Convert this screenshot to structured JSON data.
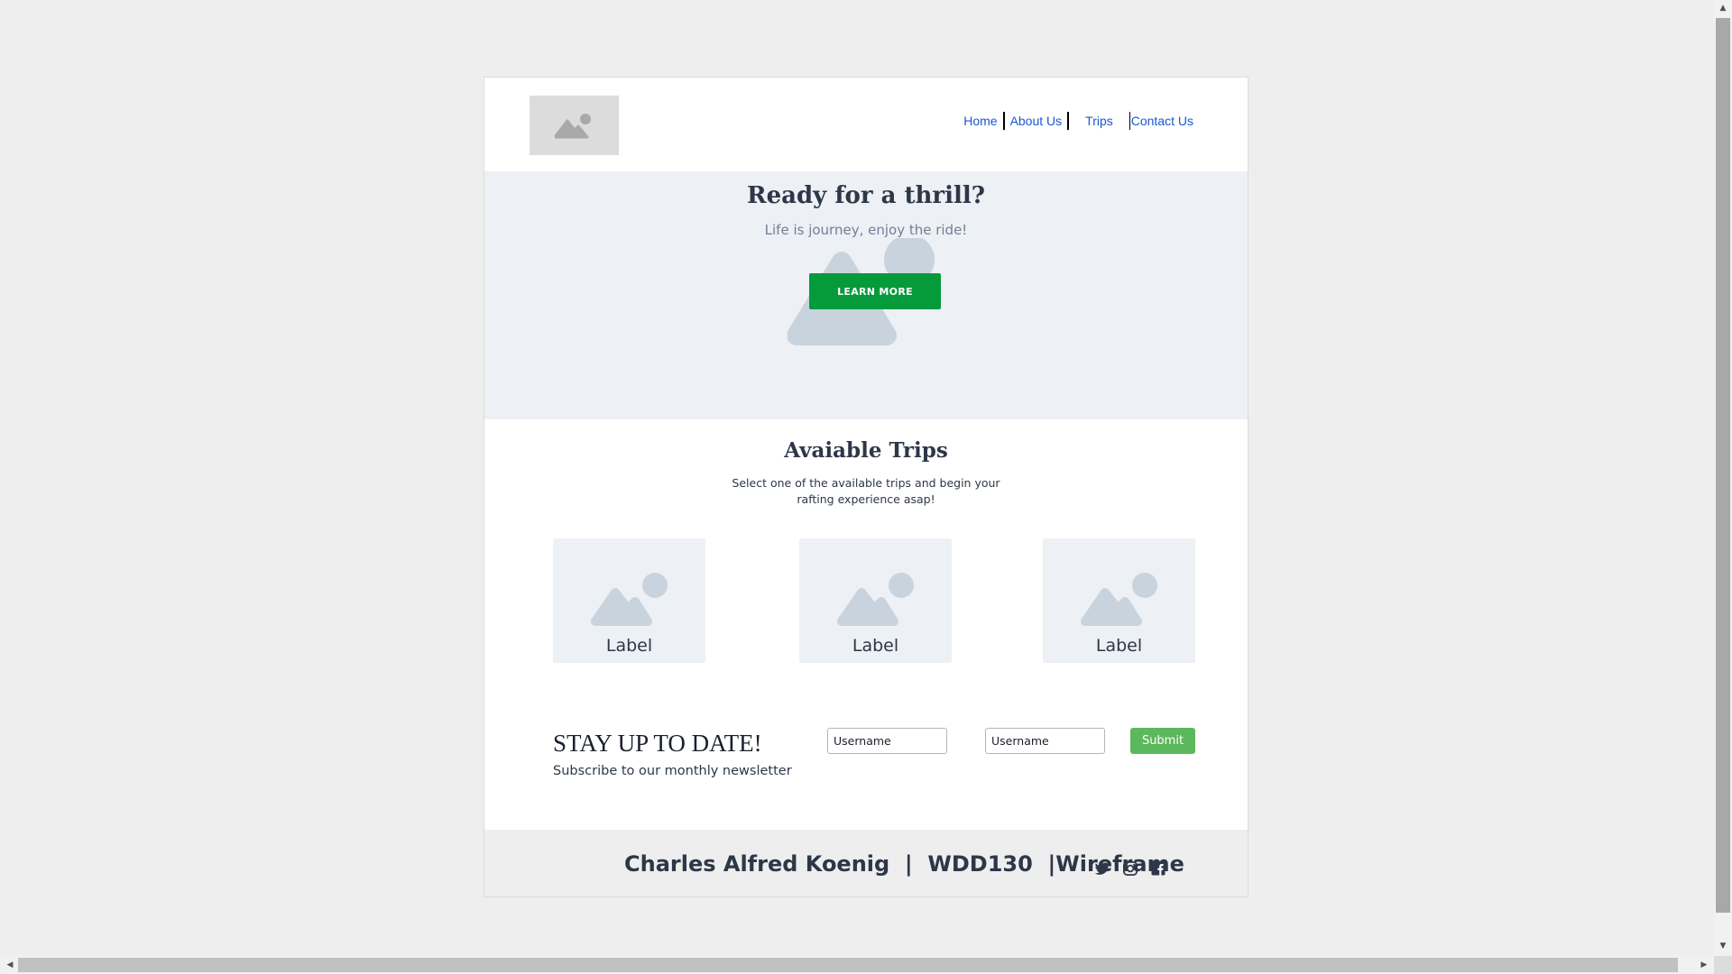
{
  "nav": {
    "items": [
      {
        "label": "Home"
      },
      {
        "label": "About Us"
      },
      {
        "label": "Trips"
      },
      {
        "label": "Contact Us"
      }
    ],
    "link_color": "#1a56d6"
  },
  "hero": {
    "title": "Ready for a thrill?",
    "subtitle": "Life is journey, enjoy the ride!",
    "button_label": "LEARN MORE",
    "button_color": "#059a3a"
  },
  "trips": {
    "title": "Avaiable Trips",
    "subtitle": "Select one of the available trips and begin your rafting experience asap!",
    "cards": [
      {
        "label": "Label",
        "icon": "image-placeholder-icon"
      },
      {
        "label": "Label",
        "icon": "image-placeholder-icon"
      },
      {
        "label": "Label",
        "icon": "image-placeholder-icon"
      }
    ]
  },
  "newsletter": {
    "title": "STAY UP TO DATE!",
    "subtitle": "Subscribe to our monthly newsletter",
    "inputs": [
      {
        "placeholder": "Username"
      },
      {
        "placeholder": "Username"
      }
    ],
    "submit_label": "Submit",
    "submit_color": "#5cb85c"
  },
  "footer": {
    "text": "Charles Alfred Koenig  |  WDD130  |Wireframe",
    "social_icons": [
      "twitter-icon",
      "instagram-icon",
      "facebook-icon"
    ]
  },
  "scrollbars": {
    "up_arrow": "▲",
    "down_arrow": "▼",
    "left_arrow": "◀",
    "right_arrow": "▶"
  }
}
